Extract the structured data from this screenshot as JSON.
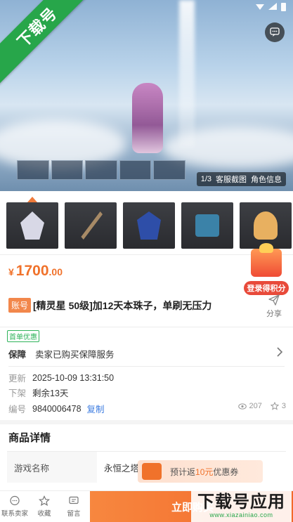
{
  "watermark": {
    "ribbon": "下载号",
    "brand": "下载号应用",
    "site": "www.xiazainiao.com"
  },
  "hero": {
    "image_counter": "1/3",
    "tab_service_screenshot": "客服截图",
    "tab_role_info": "角色信息"
  },
  "thumbnails": [
    {
      "name": "character",
      "color": "#d8d8e6"
    },
    {
      "name": "sword",
      "color": "#a78a66"
    },
    {
      "name": "gem",
      "color": "#2e4ea8"
    },
    {
      "name": "chest",
      "color": "#3b82a8"
    },
    {
      "name": "avatar",
      "color": "#e8b060"
    }
  ],
  "price": {
    "symbol": "¥",
    "integer": "1700",
    "decimal": ".00"
  },
  "promo": {
    "gift_label": "登录得积分"
  },
  "product": {
    "tag": "账号",
    "title": "[精灵星 50级]加12天本珠子，单刷无压力"
  },
  "share": {
    "label": "分享"
  },
  "first_badge": "首单优惠",
  "guarantee": {
    "label": "保障",
    "text": "卖家已购买保障服务"
  },
  "updated": {
    "label": "更新",
    "value": "2025-10-09 13:31:50"
  },
  "delist": {
    "label": "下架",
    "value": "剩余13天"
  },
  "serial": {
    "label": "编号",
    "value": "9840006478",
    "copy": "复制"
  },
  "stats": {
    "views": "207",
    "favorites": "3"
  },
  "details": {
    "section_title": "商品详情",
    "game_name_label": "游戏名称",
    "game_name_value": "永恒之塔"
  },
  "coupon": {
    "prefix": "预计返",
    "amount": "10元",
    "suffix": "优惠券"
  },
  "bottom_bar": {
    "contact": "联系卖家",
    "favorite": "收藏",
    "message": "留言",
    "buy": "立即购买"
  },
  "colors": {
    "accent": "#f0722b",
    "green": "#27a64a",
    "link": "#3b7be0"
  }
}
